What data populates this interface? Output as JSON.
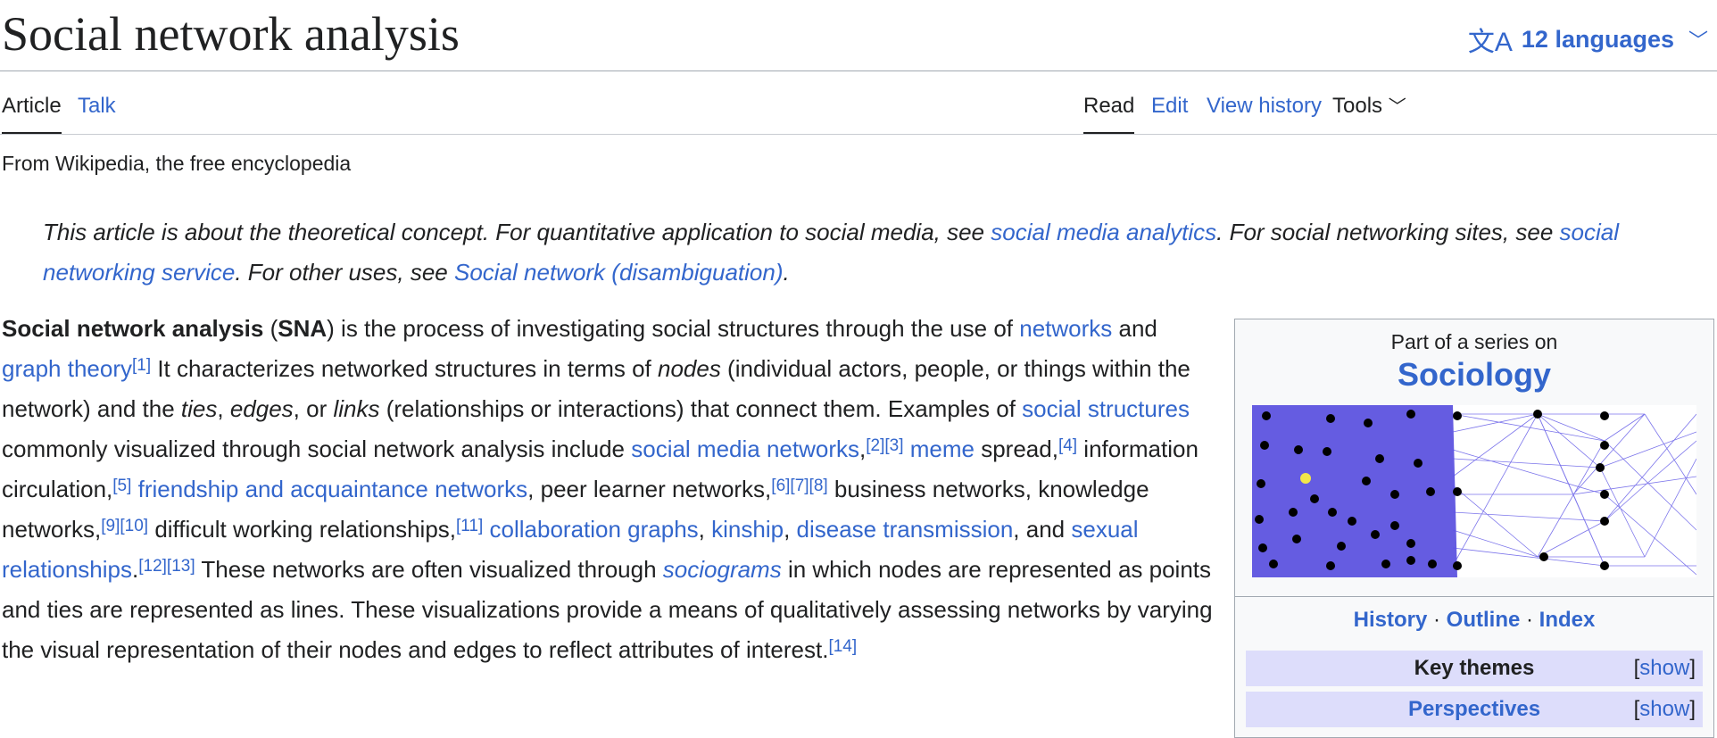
{
  "page": {
    "title": "Social network analysis",
    "languages_label": "12 languages",
    "tagline": "From Wikipedia, the free encyclopedia"
  },
  "tabs": {
    "article": "Article",
    "talk": "Talk",
    "read": "Read",
    "edit": "Edit",
    "history": "View history",
    "tools": "Tools"
  },
  "hatnote": {
    "t1": "This article is about the theoretical concept. For quantitative application to social media, see ",
    "l1": "social media analytics",
    "t2": ". For social networking sites, see ",
    "l2": "social networking service",
    "t3": ". For other uses, see ",
    "l3": "Social network (disambiguation)",
    "t4": "."
  },
  "lead": {
    "b1": "Social network analysis",
    "t1": " (",
    "b2": "SNA",
    "t2": ") is the process of investigating social structures through the use of ",
    "l_networks": "networks",
    "t3": " and ",
    "l_graph": "graph theory",
    "r1": "[1]",
    "t4": " It characterizes networked structures in terms of ",
    "i_nodes": "nodes",
    "t5": " (individual actors, people, or things within the network) and the ",
    "i_ties": "ties",
    "t6": ", ",
    "i_edges": "edges",
    "t7": ", or ",
    "i_links": "links",
    "t8": " (relationships or interactions) that connect them. Examples of ",
    "l_social_structures": "social structures",
    "t9": " commonly visualized through social network analysis include ",
    "l_social_media": "social media networks",
    "t10": ",",
    "r2": "[2]",
    "r3": "[3]",
    "t11": " ",
    "l_meme": "meme",
    "t12": " spread,",
    "r4": "[4]",
    "t13": " information circulation,",
    "r5": "[5]",
    "t14": " ",
    "l_friendship": "friendship and acquaintance networks",
    "t15": ", peer learner networks,",
    "r6": "[6]",
    "r7": "[7]",
    "r8": "[8]",
    "t16": " business networks, knowledge networks,",
    "r9": "[9]",
    "r10": "[10]",
    "t17": " difficult working relationships,",
    "r11": "[11]",
    "t18": " ",
    "l_collab": "collaboration graphs",
    "t19": ", ",
    "l_kinship": "kinship",
    "t20": ", ",
    "l_disease": "disease transmission",
    "t21": ", and ",
    "l_sexual": "sexual relationships",
    "t22": ".",
    "r12": "[12]",
    "r13": "[13]",
    "t23": " These networks are often visualized through ",
    "l_sociograms": "sociograms",
    "t24": " in which nodes are represented as points and ties are represented as lines. These visualizations provide a means of qualitatively assessing networks by varying the visual representation of their nodes and edges to reflect attributes of interest.",
    "r14": "[14]"
  },
  "infobox": {
    "part_of": "Part of a series on",
    "series": "Sociology",
    "link_history": "History",
    "sep": "·",
    "link_outline": "Outline",
    "link_index": "Index",
    "row1": "Key themes",
    "row2": "Perspectives",
    "show": "show",
    "bracket_open": "[",
    "bracket_close": "]"
  },
  "colors": {
    "link": "#3366cc",
    "infobox_header": "#ddddfb",
    "network_fill": "#4a3fdc",
    "highlight_node": "#f2e64a"
  }
}
